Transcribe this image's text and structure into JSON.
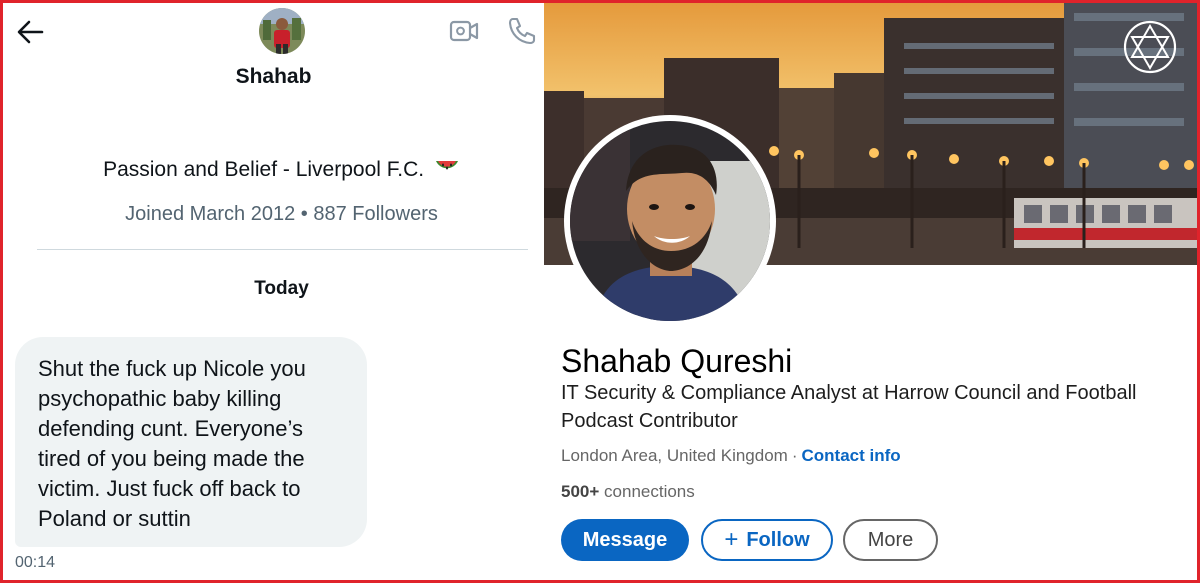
{
  "chat": {
    "contact_name": "Shahab",
    "bio": "Passion and Belief - Liverpool F.C.",
    "bio_emoji": "watermelon-icon",
    "meta": "Joined March 2012 • 887 Followers",
    "day_label": "Today",
    "message": {
      "text": "Shut the fuck up Nicole you psychopathic baby killing defending cunt. Everyone’s tired of you being made the victim. Just fuck off back to Poland or suttin",
      "time": "00:14"
    }
  },
  "profile": {
    "name": "Shahab Qureshi",
    "headline": "IT Security & Compliance Analyst at Harrow Council and Football Podcast Contributor",
    "location": "London Area, United Kingdom",
    "separator": "·",
    "contact_info": "Contact info",
    "connections_count": "500+",
    "connections_label": "connections",
    "buttons": {
      "message": "Message",
      "follow_plus": "+",
      "follow": "Follow",
      "more": "More"
    }
  },
  "colors": {
    "accent_blue": "#0a66c2",
    "frame_red": "#e0232b",
    "bubble_gray": "#eff3f4",
    "muted_text": "#536471"
  }
}
